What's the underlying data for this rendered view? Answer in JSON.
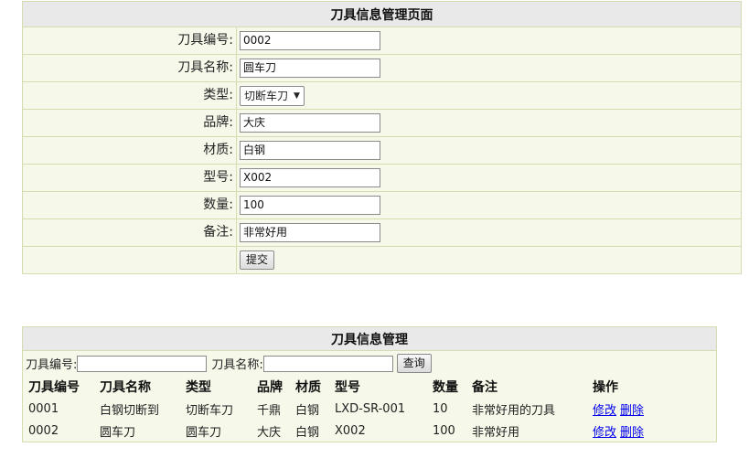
{
  "form": {
    "title": "刀具信息管理页面",
    "fields": [
      {
        "label": "刀具编号:",
        "value": "0002",
        "type": "text"
      },
      {
        "label": "刀具名称:",
        "value": "圆车刀",
        "type": "text"
      },
      {
        "label": "类型:",
        "value": "切断车刀",
        "type": "select"
      },
      {
        "label": "品牌:",
        "value": "大庆",
        "type": "text"
      },
      {
        "label": "材质:",
        "value": "白钢",
        "type": "text"
      },
      {
        "label": "型号:",
        "value": "X002",
        "type": "text"
      },
      {
        "label": "数量:",
        "value": "100",
        "type": "text"
      },
      {
        "label": "备注:",
        "value": "非常好用",
        "type": "text"
      }
    ],
    "submit_label": "提交"
  },
  "list": {
    "title": "刀具信息管理",
    "search": {
      "label_id": "刀具编号:",
      "label_name": "刀具名称:",
      "button_label": "查询"
    },
    "columns": [
      "刀具编号",
      "刀具名称",
      "类型",
      "品牌",
      "材质",
      "型号",
      "数量",
      "备注",
      "操作"
    ],
    "rows": [
      {
        "id": "0001",
        "name": "白钢切断到",
        "type": "切断车刀",
        "brand": "千鼎",
        "material": "白钢",
        "model": "LXD-SR-001",
        "qty": "10",
        "note": "非常好用的刀具",
        "edit": "修改",
        "delete": "删除"
      },
      {
        "id": "0002",
        "name": "圆车刀",
        "type": "圆车刀",
        "brand": "大庆",
        "material": "白钢",
        "model": "X002",
        "qty": "100",
        "note": "非常好用",
        "edit": "修改",
        "delete": "删除"
      }
    ]
  }
}
